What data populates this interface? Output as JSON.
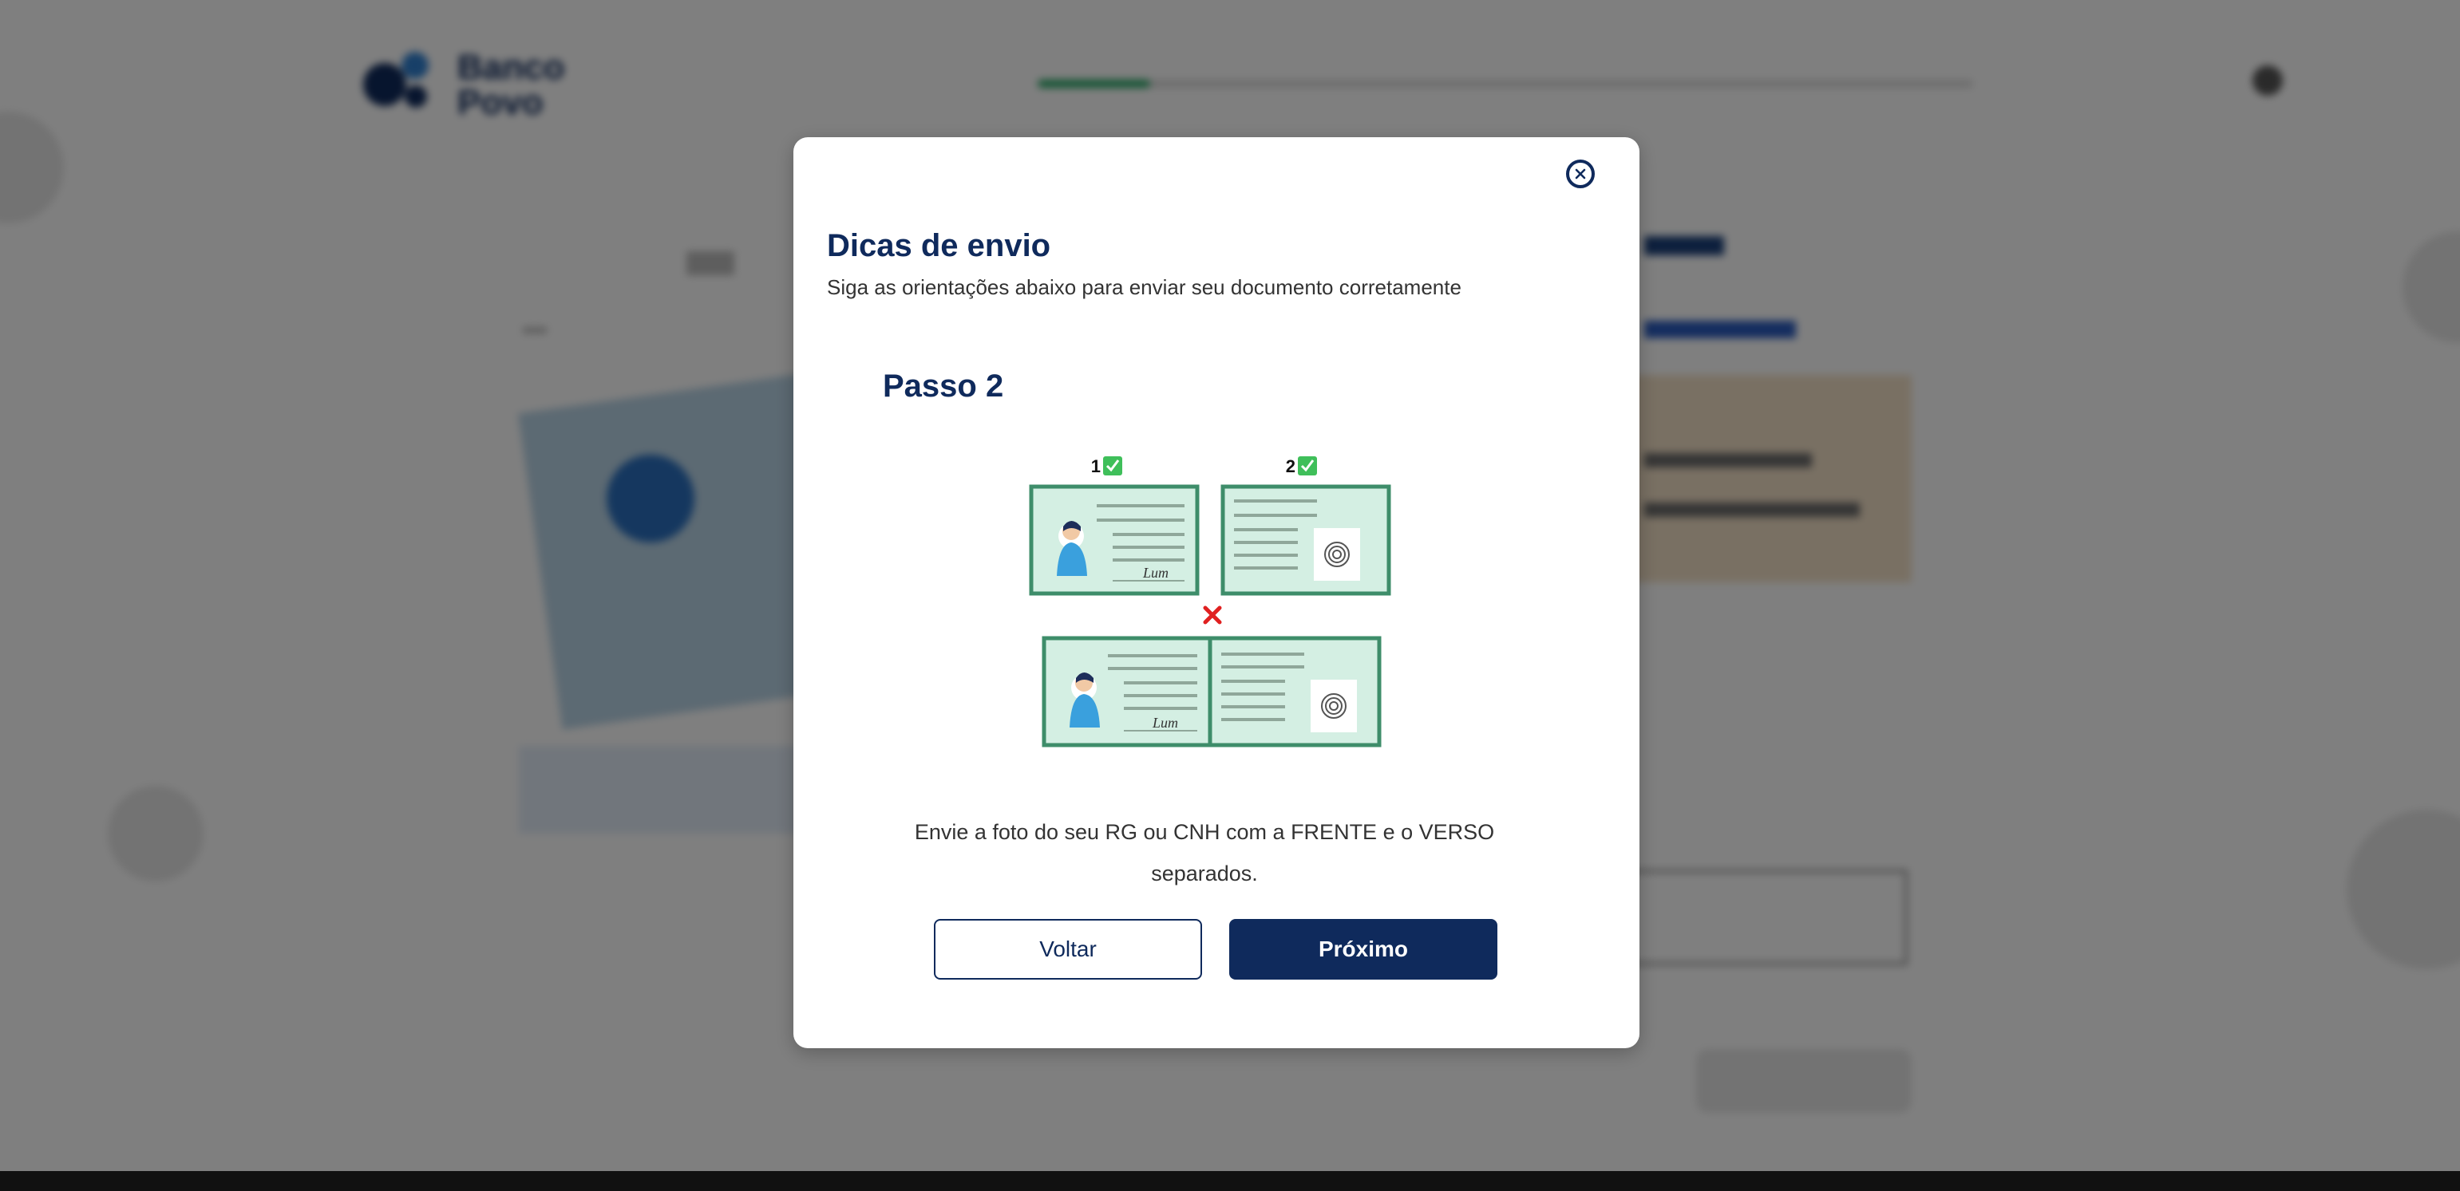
{
  "header": {
    "logo_line1": "Banco",
    "logo_line2": "Povo",
    "progress_fraction": 0.12,
    "progress_color": "#1fa35f"
  },
  "modal": {
    "title": "Dicas de envio",
    "subtitle": "Siga as orientações abaixo para enviar seu documento corretamente",
    "step_title": "Passo 2",
    "illustration": {
      "label_front": "1",
      "label_back": "2",
      "ok_icon": "check-icon",
      "bad_icon": "cross-icon",
      "signature": "Lum"
    },
    "description": "Envie a foto do seu RG ou CNH com a FRENTE e o VERSO separados.",
    "back_button": "Voltar",
    "next_button": "Próximo"
  },
  "colors": {
    "primary": "#0f2a5c",
    "success": "#1fa35f",
    "error": "#e02020",
    "card_fill": "#d4efe3",
    "card_border": "#3e8d6a"
  }
}
